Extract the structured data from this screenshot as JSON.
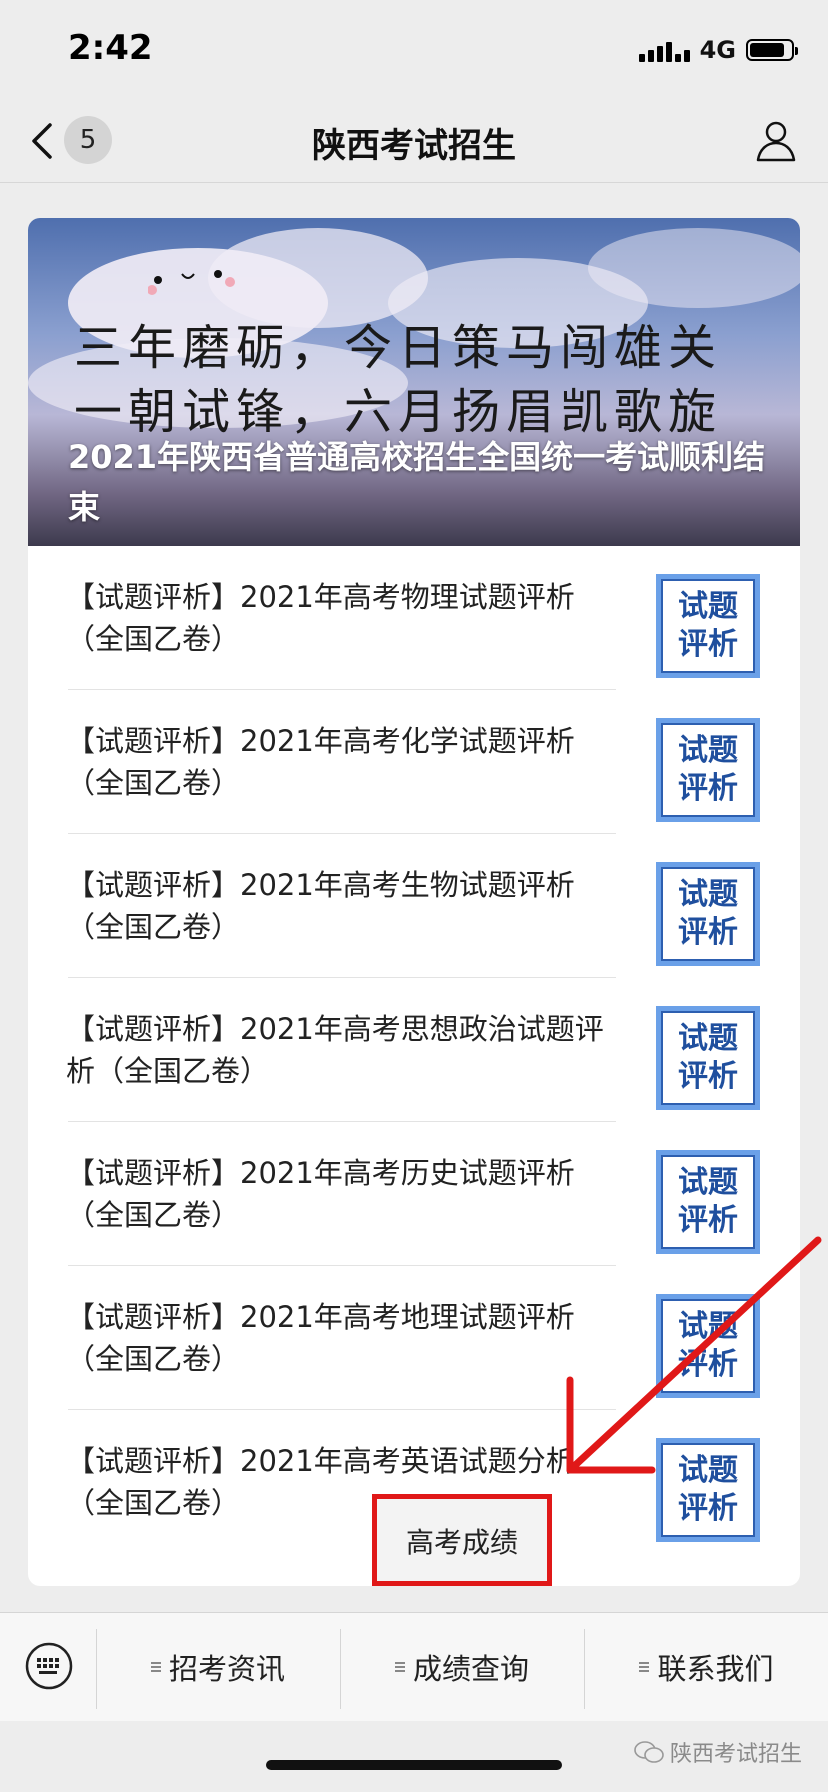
{
  "status_bar": {
    "time": "2:42",
    "network": "4G",
    "battery_level": 0.85
  },
  "nav": {
    "badge_count": "5",
    "title": "陕西考试招生"
  },
  "banner": {
    "slogan_line1": "三年磨砺，今日策马闯雄关",
    "slogan_line2": "一朝试锋，六月扬眉凯歌旋",
    "title": "2021年陕西省普通高校招生全国统一考试顺利结束"
  },
  "articles": [
    {
      "title": "【试题评析】2021年高考物理试题评析（全国乙卷）",
      "thumb": "试题评析"
    },
    {
      "title": "【试题评析】2021年高考化学试题评析（全国乙卷）",
      "thumb": "试题评析"
    },
    {
      "title": "【试题评析】2021年高考生物试题评析（全国乙卷）",
      "thumb": "试题评析"
    },
    {
      "title": "【试题评析】2021年高考思想政治试题评析（全国乙卷）",
      "thumb": "试题评析"
    },
    {
      "title": "【试题评析】2021年高考历史试题评析（全国乙卷）",
      "thumb": "试题评析"
    },
    {
      "title": "【试题评析】2021年高考地理试题评析（全国乙卷）",
      "thumb": "试题评析"
    },
    {
      "title": "【试题评析】2021年高考英语试题分析（全国乙卷）",
      "thumb": "试题评析"
    }
  ],
  "popup": {
    "label": "高考成绩"
  },
  "tabs": [
    {
      "label": "招考资讯"
    },
    {
      "label": "成绩查询"
    },
    {
      "label": "联系我们"
    }
  ],
  "watermark": "陕西考试招生",
  "colors": {
    "highlight_red": "#e01818",
    "thumb_blue": "#1f4f9e"
  }
}
